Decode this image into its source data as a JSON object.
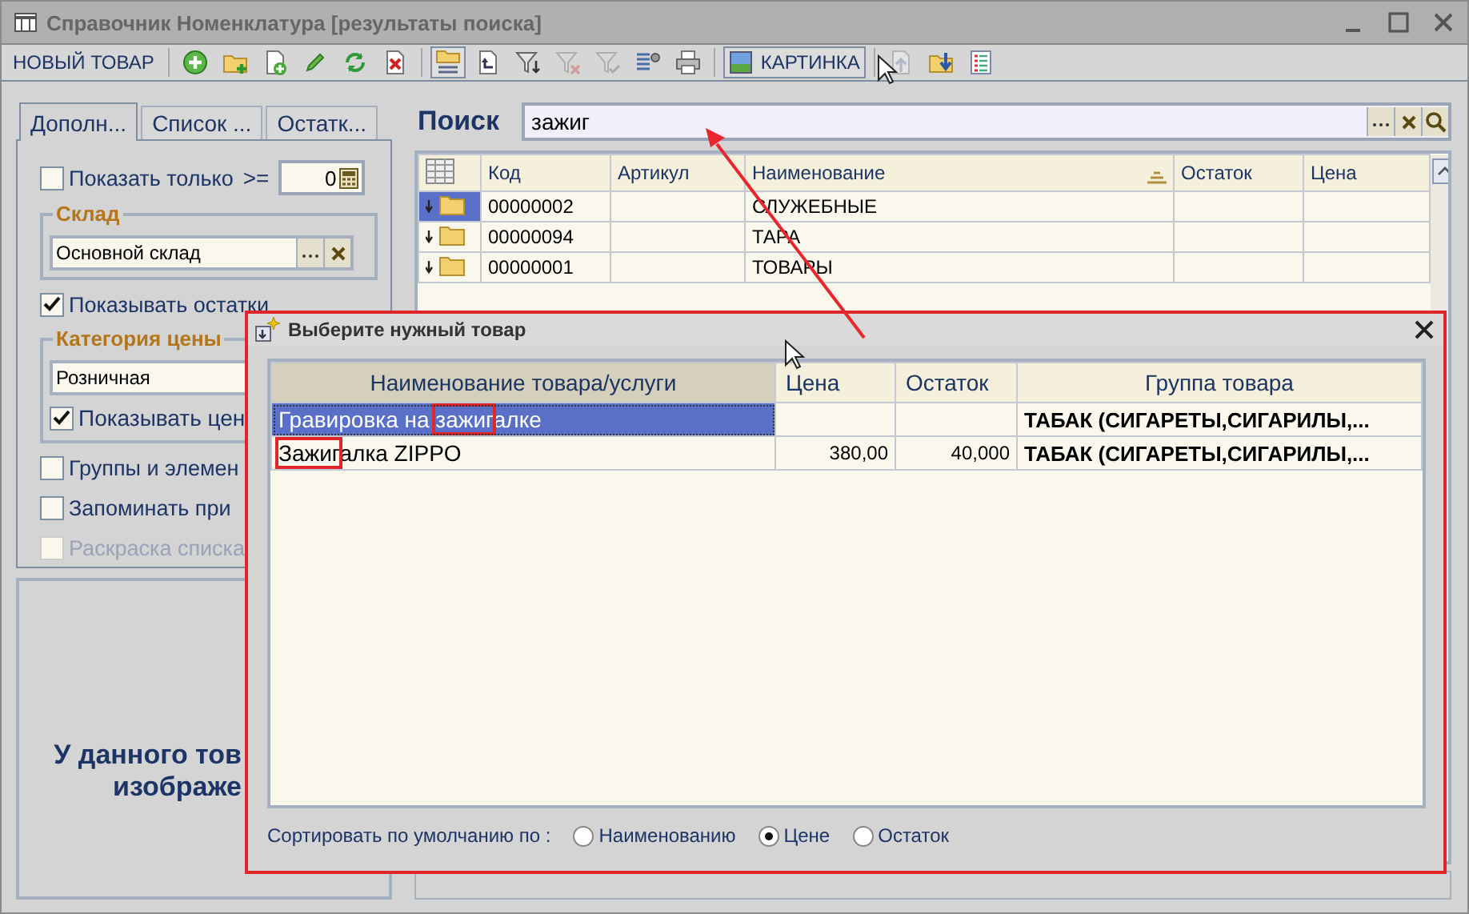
{
  "window": {
    "title": "Справочник Номенклатура [результаты поиска]"
  },
  "toolbar": {
    "new_button": "НОВЫЙ ТОВАР",
    "group_1": [
      {
        "disabled": false
      },
      {
        "disabled": false
      },
      {
        "disabled": false
      },
      {
        "disabled": false
      },
      {
        "disabled": false
      },
      {
        "disabled": false
      }
    ],
    "group_2": [
      {
        "pressed": true,
        "disabled": false
      },
      {
        "pressed": false,
        "disabled": false
      },
      {
        "pressed": false,
        "disabled": false
      },
      {
        "pressed": false,
        "disabled": true
      },
      {
        "pressed": false,
        "disabled": true
      },
      {
        "pressed": false,
        "disabled": false
      },
      {
        "pressed": false,
        "disabled": false
      }
    ],
    "picture_button": {
      "label": "КАРТИНКА",
      "pressed": true
    },
    "group_3": [
      {
        "disabled": true
      },
      {
        "disabled": false
      },
      {
        "disabled": false
      }
    ]
  },
  "left_tabs": [
    {
      "label": "Дополн...",
      "selected": true
    },
    {
      "label": "Список ...",
      "selected": false
    },
    {
      "label": "Остатк...",
      "selected": false
    }
  ],
  "options": {
    "show_only": {
      "label": "Показать только",
      "checked": false,
      "operator": ">=",
      "value": "0"
    },
    "warehouse": {
      "legend": "Склад",
      "value": "Основной склад"
    },
    "show_stock": {
      "label": "Показывать остатки",
      "checked": true
    },
    "price_category": {
      "legend": "Категория цены",
      "value": "Розничная",
      "show_prices": {
        "label": "Показывать цен",
        "checked": true
      }
    },
    "extra": [
      {
        "label": "Группы и элемен",
        "checked": false,
        "disabled": false
      },
      {
        "label": "Запоминать при",
        "checked": false,
        "disabled": false
      },
      {
        "label": "Раскраска списка",
        "checked": false,
        "disabled": true
      }
    ]
  },
  "image_panel": {
    "lines": [
      "У данного тов",
      "изображе"
    ]
  },
  "search": {
    "label": "Поиск",
    "value": "зажиг"
  },
  "grid": {
    "columns": [
      {
        "label": "Код",
        "sorted": false
      },
      {
        "label": "Артикул",
        "sorted": false
      },
      {
        "label": "Наименование",
        "sorted": true
      },
      {
        "label": "Остаток",
        "sorted": false
      },
      {
        "label": "Цена",
        "sorted": false
      }
    ],
    "rows": [
      {
        "code": "00000002",
        "name": "СЛУЖЕБНЫЕ",
        "selected": true
      },
      {
        "code": "00000094",
        "name": "ТАРА",
        "selected": false
      },
      {
        "code": "00000001",
        "name": "ТОВАРЫ",
        "selected": false
      }
    ]
  },
  "dialog": {
    "title": "Выберите нужный товар",
    "columns": [
      {
        "label": "Наименование товара/услуги",
        "sorted": true
      },
      {
        "label": "Цена",
        "sorted": false
      },
      {
        "label": "Остаток",
        "sorted": false
      },
      {
        "label": "Группа товара",
        "sorted": false
      }
    ],
    "rows": [
      {
        "name": "Гравировка на зажигалке",
        "group": "ТАБАК (СИГАРЕТЫ,СИГАРИЛЫ,...",
        "selected": true
      },
      {
        "name": "Зажигалка ZIPPO",
        "price": "380,00",
        "stock": "40,000",
        "group": "ТАБАК (СИГАРЕТЫ,СИГАРИЛЫ,...",
        "selected": false
      }
    ],
    "sort": {
      "label": "Сортировать по умолчанию по :",
      "options": [
        {
          "label": "Наименованию",
          "selected": false
        },
        {
          "label": "Цене",
          "selected": true
        },
        {
          "label": "Остаток",
          "selected": false
        }
      ]
    }
  }
}
